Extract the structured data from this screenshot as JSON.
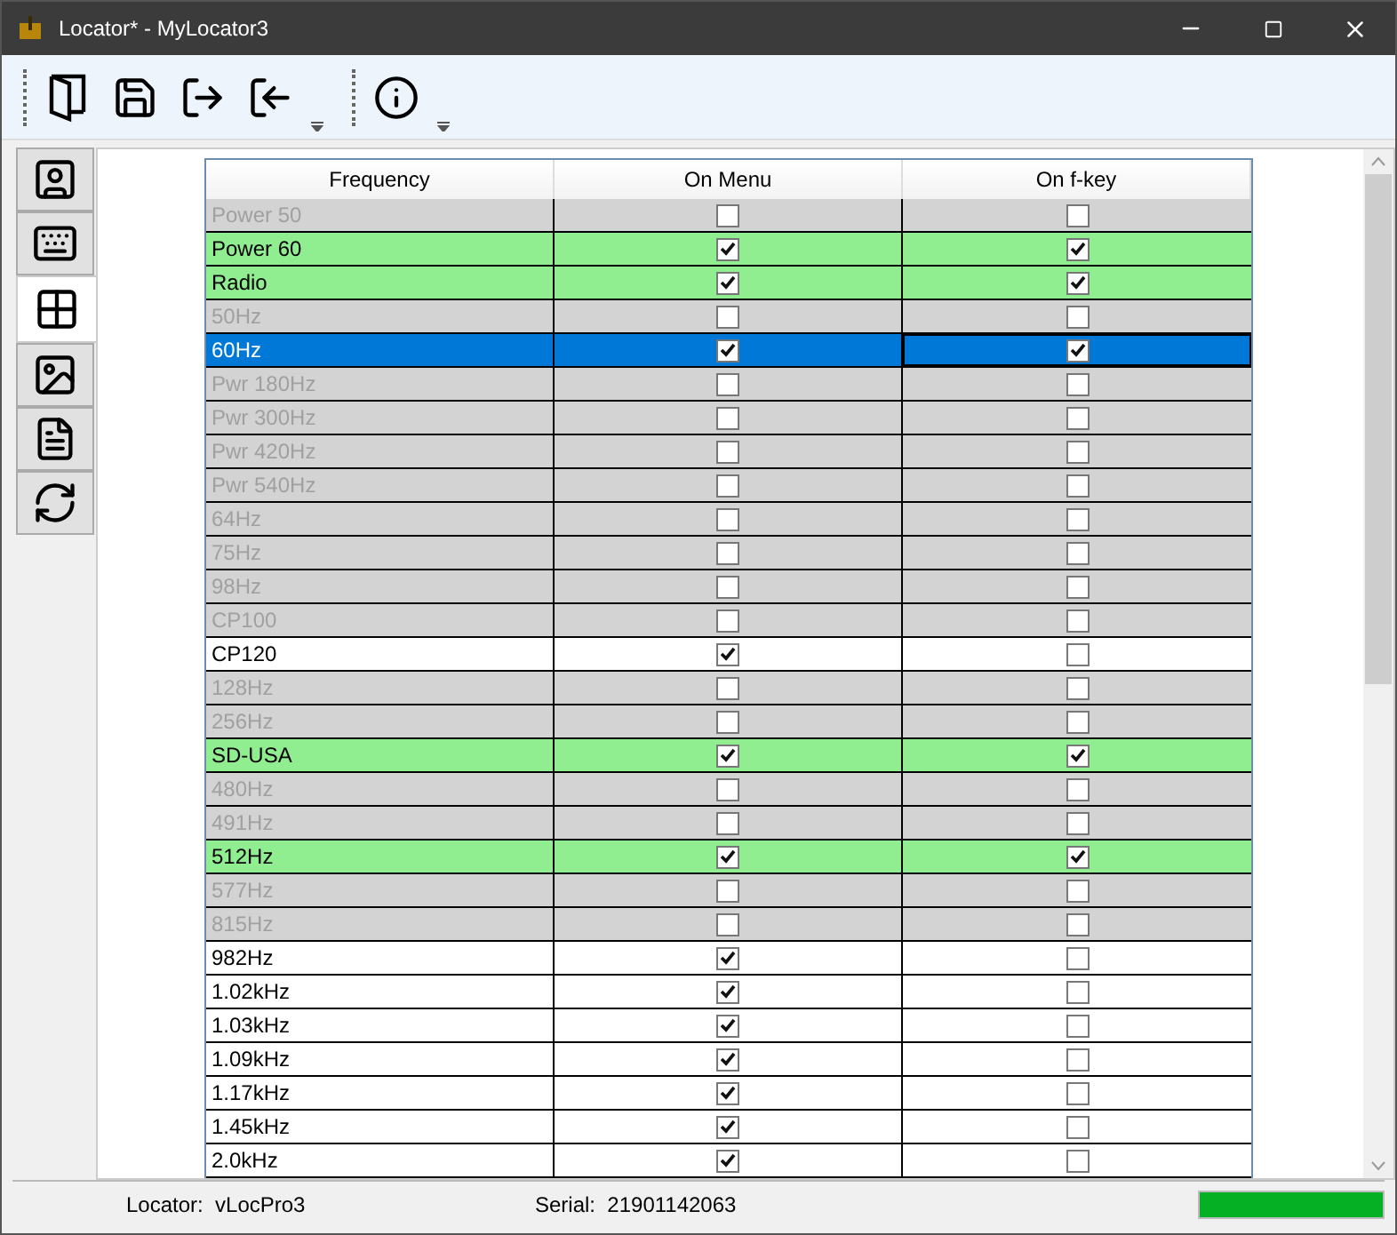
{
  "window": {
    "title": "Locator* - MyLocator3"
  },
  "side_tabs": [
    {
      "selected": false
    },
    {
      "selected": false
    },
    {
      "selected": true
    },
    {
      "selected": false
    },
    {
      "selected": false
    },
    {
      "selected": false
    }
  ],
  "table": {
    "columns": [
      "Frequency",
      "On Menu",
      "On f-key"
    ],
    "rows": [
      {
        "frequency": "Power 50",
        "disabled": true,
        "highlighted": false,
        "selected": false,
        "on_menu": false,
        "on_fkey": false
      },
      {
        "frequency": "Power 60",
        "disabled": false,
        "highlighted": true,
        "selected": false,
        "on_menu": true,
        "on_fkey": true
      },
      {
        "frequency": "Radio",
        "disabled": false,
        "highlighted": true,
        "selected": false,
        "on_menu": true,
        "on_fkey": true
      },
      {
        "frequency": "50Hz",
        "disabled": true,
        "highlighted": false,
        "selected": false,
        "on_menu": false,
        "on_fkey": false
      },
      {
        "frequency": "60Hz",
        "disabled": false,
        "highlighted": false,
        "selected": true,
        "on_menu": true,
        "on_fkey": true
      },
      {
        "frequency": "Pwr 180Hz",
        "disabled": true,
        "highlighted": false,
        "selected": false,
        "on_menu": false,
        "on_fkey": false
      },
      {
        "frequency": "Pwr 300Hz",
        "disabled": true,
        "highlighted": false,
        "selected": false,
        "on_menu": false,
        "on_fkey": false
      },
      {
        "frequency": "Pwr 420Hz",
        "disabled": true,
        "highlighted": false,
        "selected": false,
        "on_menu": false,
        "on_fkey": false
      },
      {
        "frequency": "Pwr 540Hz",
        "disabled": true,
        "highlighted": false,
        "selected": false,
        "on_menu": false,
        "on_fkey": false
      },
      {
        "frequency": "64Hz",
        "disabled": true,
        "highlighted": false,
        "selected": false,
        "on_menu": false,
        "on_fkey": false
      },
      {
        "frequency": "75Hz",
        "disabled": true,
        "highlighted": false,
        "selected": false,
        "on_menu": false,
        "on_fkey": false
      },
      {
        "frequency": "98Hz",
        "disabled": true,
        "highlighted": false,
        "selected": false,
        "on_menu": false,
        "on_fkey": false
      },
      {
        "frequency": "CP100",
        "disabled": true,
        "highlighted": false,
        "selected": false,
        "on_menu": false,
        "on_fkey": false
      },
      {
        "frequency": "CP120",
        "disabled": false,
        "highlighted": false,
        "selected": false,
        "on_menu": true,
        "on_fkey": false
      },
      {
        "frequency": "128Hz",
        "disabled": true,
        "highlighted": false,
        "selected": false,
        "on_menu": false,
        "on_fkey": false
      },
      {
        "frequency": "256Hz",
        "disabled": true,
        "highlighted": false,
        "selected": false,
        "on_menu": false,
        "on_fkey": false
      },
      {
        "frequency": "SD-USA",
        "disabled": false,
        "highlighted": true,
        "selected": false,
        "on_menu": true,
        "on_fkey": true
      },
      {
        "frequency": "480Hz",
        "disabled": true,
        "highlighted": false,
        "selected": false,
        "on_menu": false,
        "on_fkey": false
      },
      {
        "frequency": "491Hz",
        "disabled": true,
        "highlighted": false,
        "selected": false,
        "on_menu": false,
        "on_fkey": false
      },
      {
        "frequency": "512Hz",
        "disabled": false,
        "highlighted": true,
        "selected": false,
        "on_menu": true,
        "on_fkey": true
      },
      {
        "frequency": "577Hz",
        "disabled": true,
        "highlighted": false,
        "selected": false,
        "on_menu": false,
        "on_fkey": false
      },
      {
        "frequency": "815Hz",
        "disabled": true,
        "highlighted": false,
        "selected": false,
        "on_menu": false,
        "on_fkey": false
      },
      {
        "frequency": "982Hz",
        "disabled": false,
        "highlighted": false,
        "selected": false,
        "on_menu": true,
        "on_fkey": false
      },
      {
        "frequency": "1.02kHz",
        "disabled": false,
        "highlighted": false,
        "selected": false,
        "on_menu": true,
        "on_fkey": false
      },
      {
        "frequency": "1.03kHz",
        "disabled": false,
        "highlighted": false,
        "selected": false,
        "on_menu": true,
        "on_fkey": false
      },
      {
        "frequency": "1.09kHz",
        "disabled": false,
        "highlighted": false,
        "selected": false,
        "on_menu": true,
        "on_fkey": false
      },
      {
        "frequency": "1.17kHz",
        "disabled": false,
        "highlighted": false,
        "selected": false,
        "on_menu": true,
        "on_fkey": false
      },
      {
        "frequency": "1.45kHz",
        "disabled": false,
        "highlighted": false,
        "selected": false,
        "on_menu": true,
        "on_fkey": false
      },
      {
        "frequency": "2.0kHz",
        "disabled": false,
        "highlighted": false,
        "selected": false,
        "on_menu": true,
        "on_fkey": false
      }
    ]
  },
  "status_bar": {
    "locator": "Locator:  vLocPro3",
    "serial": "Serial:  21901142063",
    "level": 1
  }
}
